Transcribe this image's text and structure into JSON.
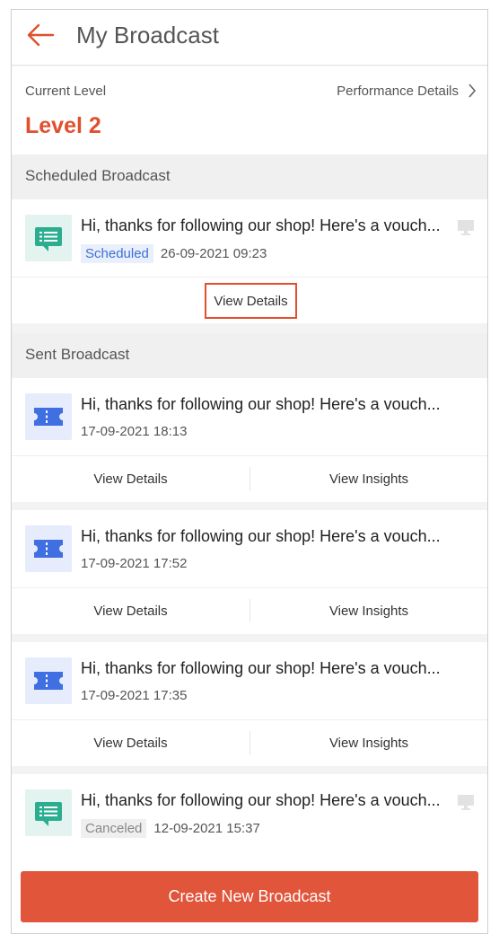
{
  "header": {
    "title": "My Broadcast"
  },
  "level": {
    "current_label": "Current Level",
    "value": "Level 2",
    "performance_link": "Performance Details"
  },
  "scheduled": {
    "section_title": "Scheduled Broadcast",
    "item": {
      "message": "Hi, thanks for following our shop! Here's a vouch...",
      "status": "Scheduled",
      "datetime": "26-09-2021 09:23",
      "view_details": "View Details"
    }
  },
  "sent": {
    "section_title": "Sent Broadcast",
    "items": [
      {
        "message": "Hi, thanks for following our shop! Here's a vouch...",
        "datetime": "17-09-2021 18:13",
        "view_details": "View Details",
        "view_insights": "View Insights"
      },
      {
        "message": "Hi, thanks for following our shop! Here's a vouch...",
        "datetime": "17-09-2021 17:52",
        "view_details": "View Details",
        "view_insights": "View Insights"
      },
      {
        "message": "Hi, thanks for following our shop! Here's a vouch...",
        "datetime": "17-09-2021 17:35",
        "view_details": "View Details",
        "view_insights": "View Insights"
      },
      {
        "message": "Hi, thanks for following our shop! Here's a vouch...",
        "status": "Canceled",
        "datetime": "12-09-2021 15:37"
      }
    ]
  },
  "footer": {
    "create_button": "Create New Broadcast"
  },
  "colors": {
    "accent": "#e0502c",
    "scheduled_badge": "#3d6fd8",
    "chat_icon": "#2bae8f",
    "voucher_icon": "#3f6fe0"
  }
}
